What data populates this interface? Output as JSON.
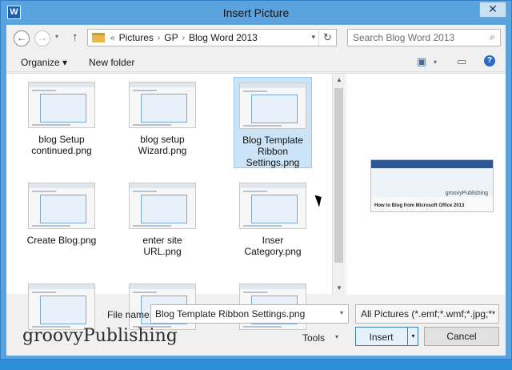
{
  "window": {
    "title": "Insert Picture",
    "app_icon_letter": "W",
    "close_symbol": "✕"
  },
  "nav": {
    "back_icon": "←",
    "forward_icon": "→",
    "up_icon": "↑",
    "crumb_prefix": "«",
    "breadcrumbs": [
      "Pictures",
      "GP",
      "Blog Word 2013"
    ],
    "search_placeholder": "Search Blog Word 2013"
  },
  "toolbar": {
    "organize": "Organize ▾",
    "new_folder": "New folder"
  },
  "files": [
    {
      "label": "blog Setup continued.png",
      "selected": false
    },
    {
      "label": "blog setup Wizard.png",
      "selected": false
    },
    {
      "label": "Blog Template Ribbon Settings.png",
      "selected": true
    },
    {
      "label": "Create Blog.png",
      "selected": false
    },
    {
      "label": "enter site URL.png",
      "selected": false
    },
    {
      "label": "Inser Category.png",
      "selected": false
    },
    {
      "label": "",
      "selected": false
    },
    {
      "label": "",
      "selected": false
    },
    {
      "label": "",
      "selected": false
    }
  ],
  "preview": {
    "caption": "How to Blog from Microsoft Office 2013",
    "watermark": "groovyPublishing"
  },
  "bottom": {
    "file_name_label": "File name:",
    "file_name_value": "Blog Template Ribbon Settings.png",
    "filter_value": "All Pictures (*.emf;*.wmf;*.jpg;*",
    "tools_label": "Tools",
    "insert_label": "Insert",
    "cancel_label": "Cancel"
  },
  "brand": "groovyPublishing"
}
